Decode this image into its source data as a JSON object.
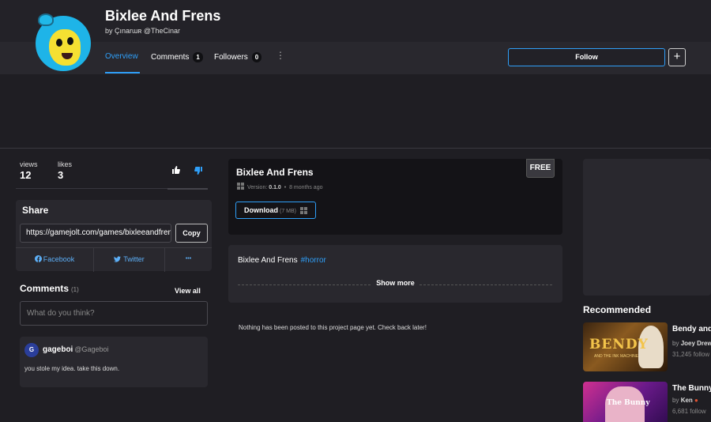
{
  "header": {
    "title": "Bixlee And Frens",
    "byline": "by Çınarɯʀ @TheCinar",
    "tabs": [
      {
        "label": "Overview"
      },
      {
        "label": "Comments",
        "count": "1"
      },
      {
        "label": "Followers",
        "count": "0"
      }
    ],
    "follow_label": "Follow",
    "plus_label": "+"
  },
  "stats": {
    "views_label": "views",
    "views_value": "12",
    "likes_label": "likes",
    "likes_value": "3"
  },
  "share": {
    "title": "Share",
    "url": "https://gamejolt.com/games/bixleeandfrens",
    "copy_label": "Copy",
    "facebook_label": "Facebook",
    "twitter_label": "Twitter",
    "more_label": "•••"
  },
  "comments": {
    "title": "Comments",
    "count": "(1)",
    "view_all": "View all",
    "placeholder": "What do you think?",
    "items": [
      {
        "user": "gageboi",
        "handle": "@Gageboi",
        "text": "you stole my idea. take this down."
      }
    ]
  },
  "release": {
    "title": "Bixlee And Frens",
    "price_badge": "FREE",
    "version_label": "Version:",
    "version": "0.1.0",
    "age": "8 months ago",
    "download_label": "Download",
    "download_size": "(7 MB)"
  },
  "description": {
    "text": "Bixlee And Frens",
    "tag": "#horror",
    "show_more": "Show more"
  },
  "empty_note": "Nothing has been posted to this project page yet. Check back later!",
  "recommended": {
    "title": "Recommended",
    "items": [
      {
        "name": "Bendy and",
        "by": "by",
        "author": "Joey Drew",
        "followers": "31,245 follow",
        "thumb_text": "BENDY",
        "thumb_sub": "AND THE INK MACHINE"
      },
      {
        "name": "The Bunny",
        "by": "by",
        "author": "Ken",
        "followers": "6,681 follow",
        "thumb_text": "The Bunny"
      }
    ]
  },
  "colors": {
    "accent": "#2f9ff8",
    "background": "#1f1e23",
    "card": "#29282e"
  }
}
